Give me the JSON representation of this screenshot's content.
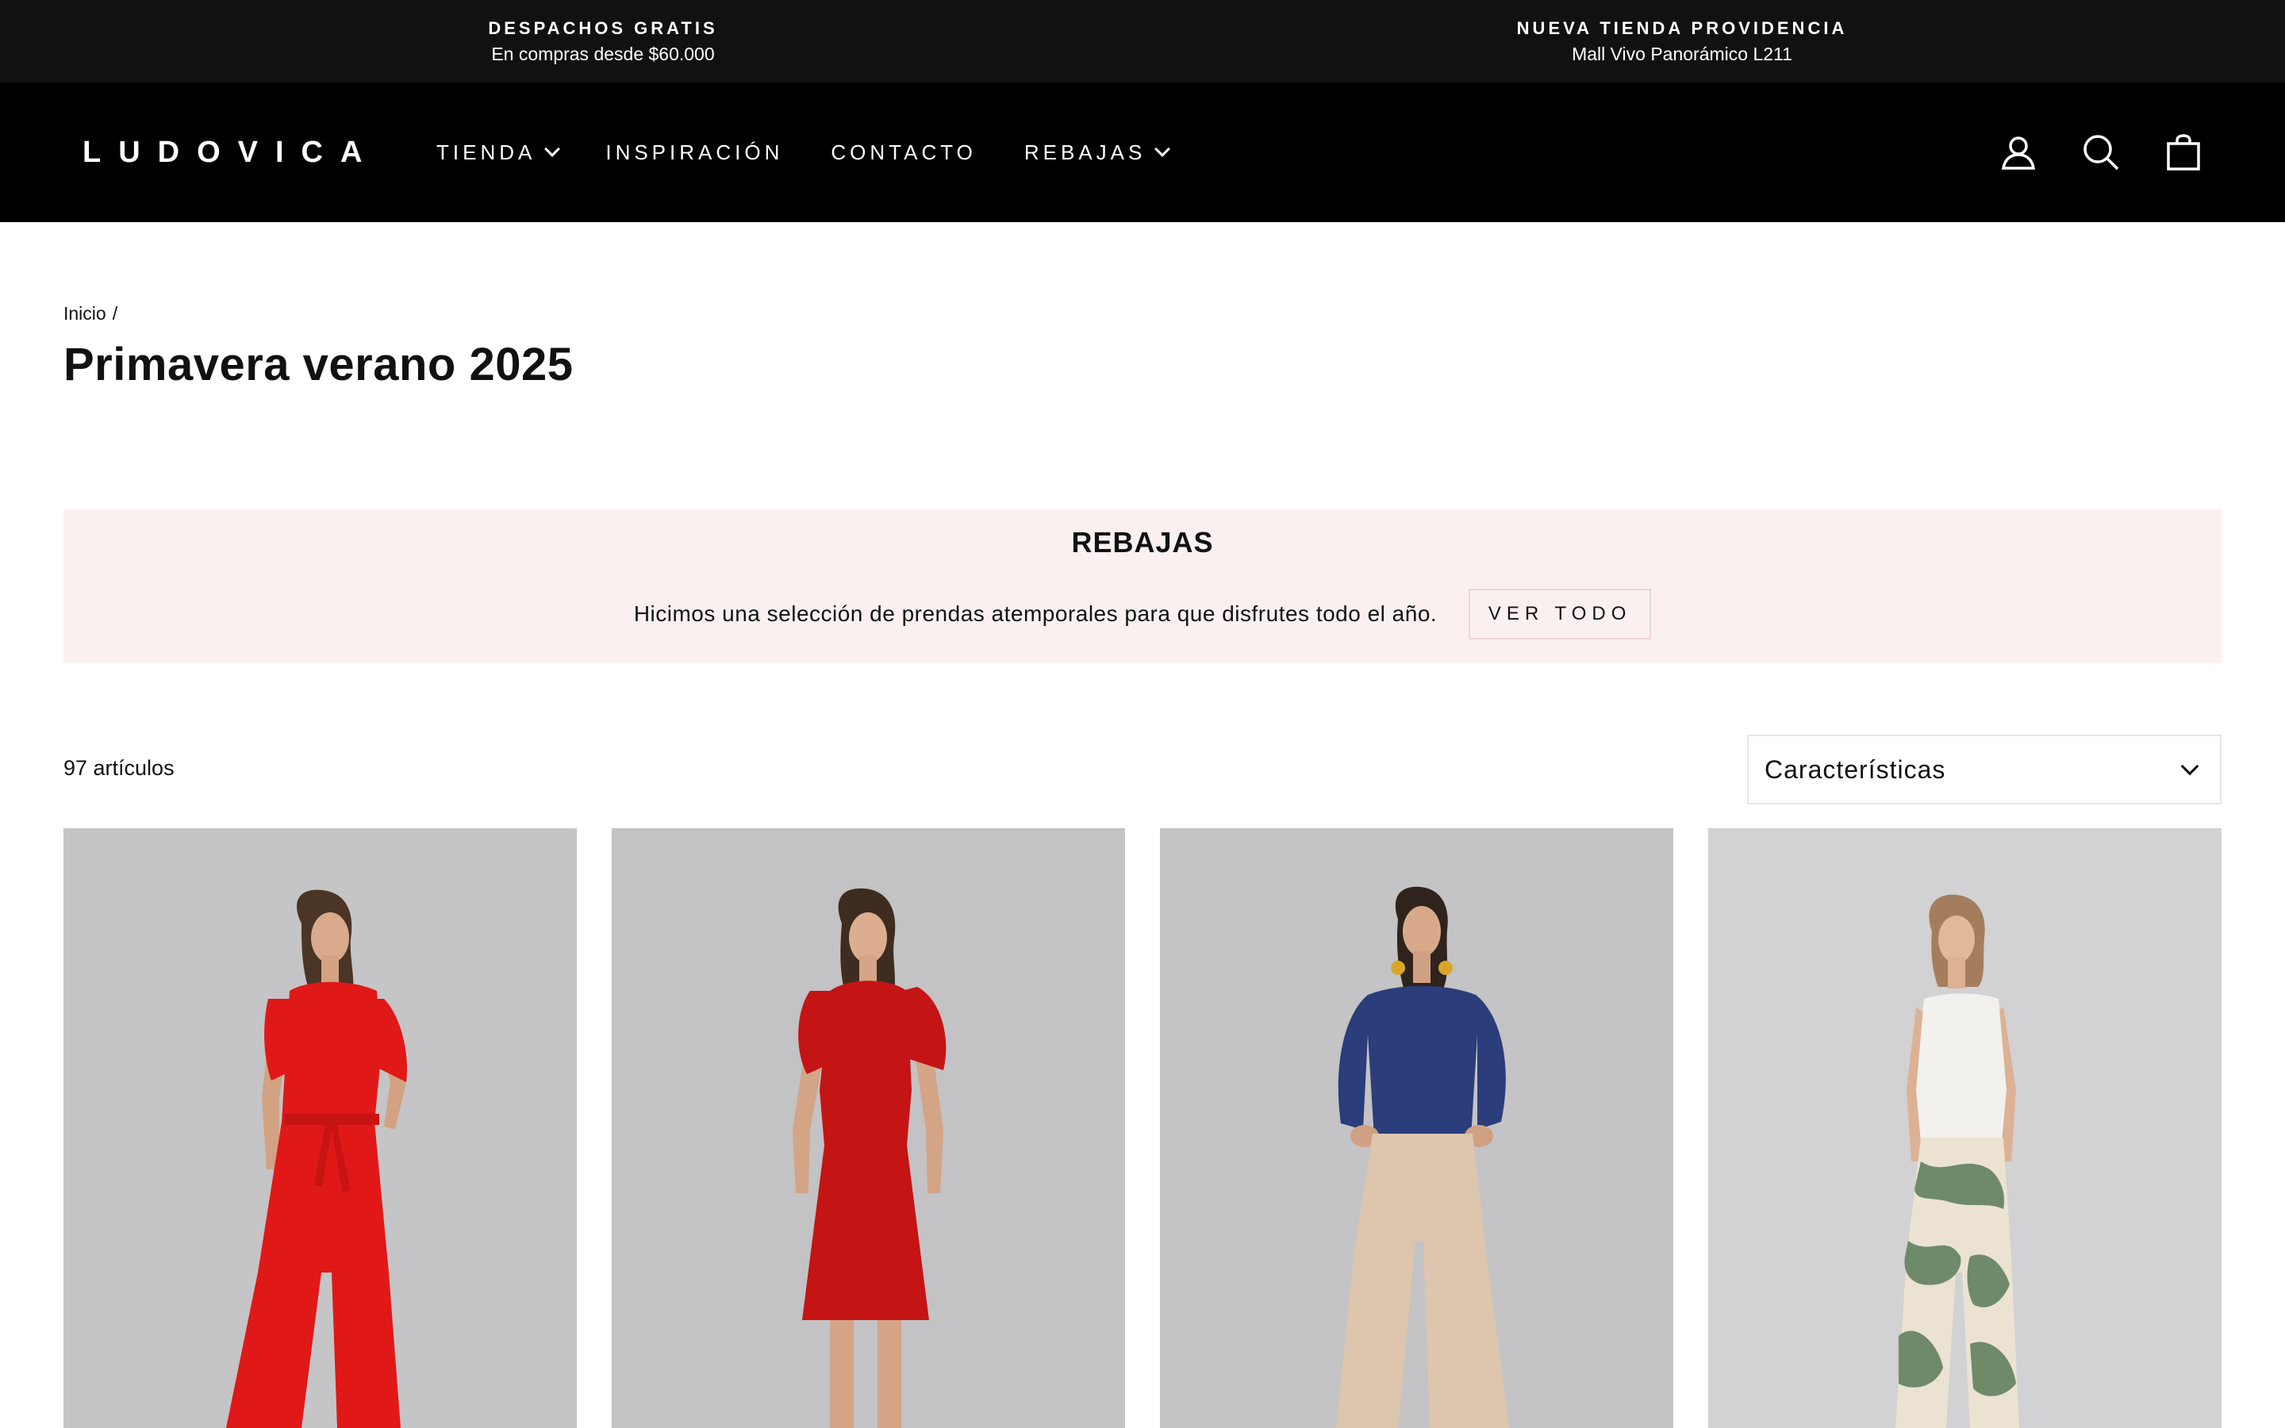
{
  "announcements": [
    {
      "title": "DESPACHOS GRATIS",
      "subtitle": "En compras desde $60.000"
    },
    {
      "title": "NUEVA TIENDA PROVIDENCIA",
      "subtitle": "Mall Vivo Panorámico L211"
    }
  ],
  "header": {
    "logo": "LUDOVICA",
    "nav": [
      {
        "label": "TIENDA",
        "has_dropdown": true
      },
      {
        "label": "INSPIRACIÓN",
        "has_dropdown": false
      },
      {
        "label": "CONTACTO",
        "has_dropdown": false
      },
      {
        "label": "REBAJAS",
        "has_dropdown": true
      }
    ],
    "icons": [
      "user-icon",
      "search-icon",
      "bag-icon"
    ]
  },
  "breadcrumb": {
    "home": "Inicio",
    "separator": "/"
  },
  "page_title": "Primavera verano 2025",
  "promo": {
    "title": "REBAJAS",
    "text": "Hicimos una selección de prendas atemporales para que disfrutes todo el año.",
    "button": "VER TODO"
  },
  "toolbar": {
    "count": "97 artículos",
    "sort_value": "Características"
  },
  "products": [
    {
      "garment": "red jumpsuit",
      "color": "#e01818",
      "background": "#c5c4c6"
    },
    {
      "garment": "red dress",
      "color": "#c41414",
      "background": "#c3c2c4"
    },
    {
      "garment": "navy top with beige wide pants",
      "color": "#2b3d7a",
      "background": "#c4c3c5"
    },
    {
      "garment": "white top with green marble pants",
      "color": "#6e8a6b",
      "background": "#d2d1d3"
    }
  ],
  "colors": {
    "announce_bg": "#111111",
    "header_bg": "#000000",
    "promo_bg": "#fbf0f0",
    "text": "#111111"
  }
}
